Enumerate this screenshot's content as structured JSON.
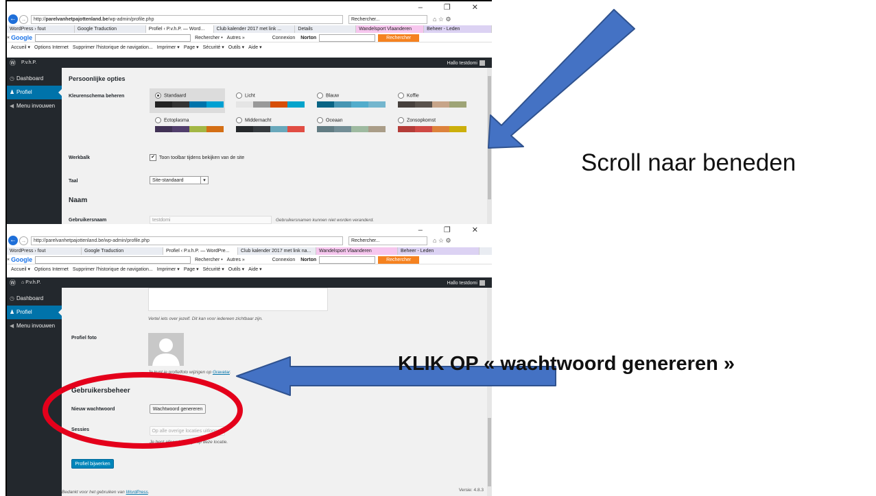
{
  "browser": {
    "url_prefix": "http://",
    "url_host": "parelvanhetpajottenland.be",
    "url_path": "/wp-admin/profile.php",
    "search_placeholder": "Rechercher...",
    "window_controls": "– ❐ ✕"
  },
  "tabs_top": [
    "WordPress › fout",
    "Google Traduction",
    "Profiel ‹ P.v.h.P. — Word...",
    "Club kalender 2017 met link ...",
    "Details",
    "Wandelsport Vlaanderen",
    "Beheer - Leden"
  ],
  "tabs_bottom": [
    "WordPress › fout",
    "Google Traduction",
    "Profiel ‹ P.v.h.P. — WordPre...",
    "Club kalender 2017 met link na...",
    "Wandelsport Vlaanderen",
    "Beheer - Leden"
  ],
  "google_bar": {
    "close": "×",
    "logo": "Google",
    "rechercher": "Rechercher •",
    "autres": "Autres »",
    "connexion": "Connexion",
    "norton": "Norton",
    "rechercher_btn": "Rechercher"
  },
  "menu_bar": [
    "Accueil ▾",
    "Options Internet",
    "Supprimer l'historique de navigation...",
    "Imprimer ▾",
    "Page ▾",
    "Sécurité ▾",
    "Outils ▾",
    "Aide ▾"
  ],
  "admin_bar": {
    "site_name": "P.v.h.P.",
    "greeting": "Hallo testdomi"
  },
  "sidebar": {
    "items": [
      "Dashboard",
      "Profiel",
      "Menu invouwen"
    ]
  },
  "profile_top": {
    "section_title": "Persoonlijke opties",
    "color_scheme_label": "Kleurenschema beheren",
    "schemes": [
      {
        "name": "Standaard",
        "colors": [
          "#222222",
          "#333333",
          "#0073aa",
          "#00a0d2"
        ]
      },
      {
        "name": "Licht",
        "colors": [
          "#e5e5e5",
          "#999999",
          "#d64e07",
          "#04a4cc"
        ]
      },
      {
        "name": "Blauw",
        "colors": [
          "#096484",
          "#4796b3",
          "#52accc",
          "#74b6ce"
        ]
      },
      {
        "name": "Koffie",
        "colors": [
          "#46403c",
          "#59524c",
          "#c7a589",
          "#9ea476"
        ]
      },
      {
        "name": "Ectoplasma",
        "colors": [
          "#413256",
          "#523f6d",
          "#a3b745",
          "#d46f15"
        ]
      },
      {
        "name": "Middernacht",
        "colors": [
          "#25282b",
          "#363b3f",
          "#69a8bb",
          "#e14d43"
        ]
      },
      {
        "name": "Oceaan",
        "colors": [
          "#627c83",
          "#738e96",
          "#9ebaa0",
          "#aa9d88"
        ]
      },
      {
        "name": "Zonsopkomst",
        "colors": [
          "#b43c38",
          "#cf4944",
          "#dd823b",
          "#ccaf0b"
        ]
      }
    ],
    "toolbar_label": "Werkbalk",
    "toolbar_checkbox": "Toon toolbar tijdens bekijken van de site",
    "language_label": "Taal",
    "language_value": "Site-standaard",
    "name_heading": "Naam",
    "username_label": "Gebruikersnaam",
    "username_value": "testdomi",
    "username_note": "Gebruikersnamen kunnen niet worden veranderd."
  },
  "profile_bottom": {
    "bio_note": "Vertel iets over jezelf. Dit kan voor iedereen zichtbaar zijn.",
    "photo_label": "Profiel foto",
    "photo_note_prefix": "Je kunt je profielfoto wijzigen op ",
    "photo_note_link": "Gravatar",
    "photo_note_suffix": ".",
    "account_heading": "Gebruikersbeheer",
    "new_password_label": "Nieuw wachtwoord",
    "generate_button": "Wachtwoord genereren",
    "sessions_label": "Sessies",
    "logout_button": "Op alle overige locaties uitloggen",
    "sessions_note": "Je bent alleen ingelogd op deze locatie.",
    "update_button": "Profiel bijwerken",
    "footer_prefix": "Bedankt voor het gebruiken van ",
    "footer_link": "WordPress",
    "footer_suffix": ".",
    "version": "Versie: 4.8.3"
  },
  "annotations": {
    "scroll_text": "Scroll naar beneden",
    "click_text": "KLIK OP « wachtwoord genereren »",
    "arrow_color": "#4472c4",
    "ellipse_color": "#e4001b"
  }
}
